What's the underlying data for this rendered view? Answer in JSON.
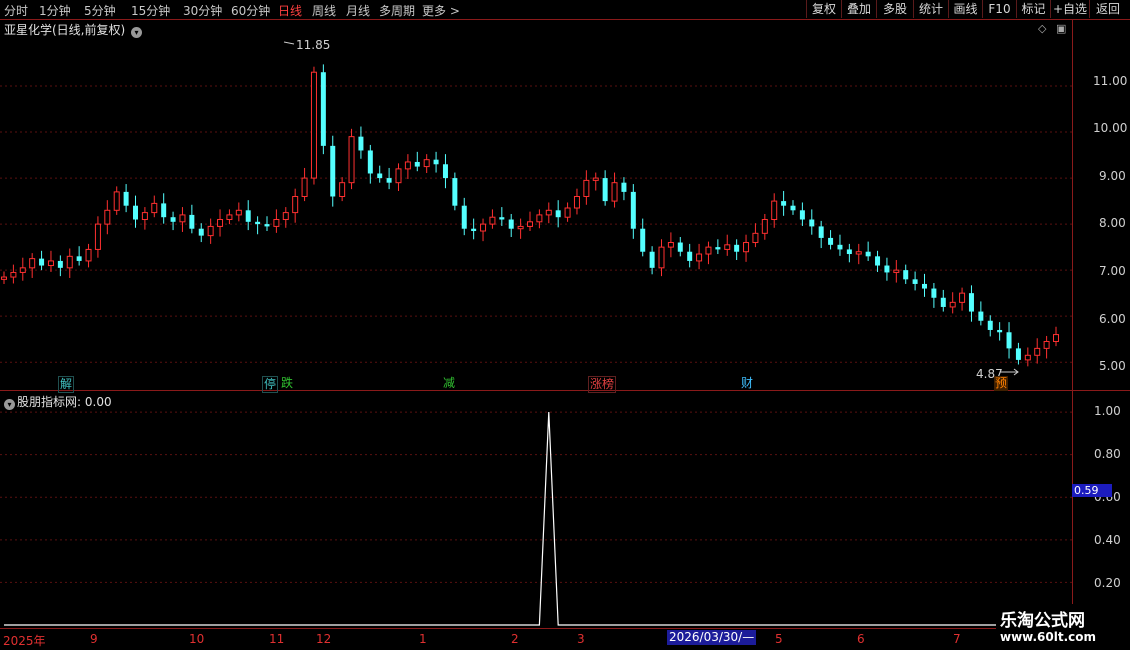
{
  "toolbar": {
    "periods": [
      "分时",
      "1分钟",
      "5分钟",
      "15分钟",
      "30分钟",
      "60分钟",
      "日线",
      "周线",
      "月线",
      "多周期",
      "更多"
    ],
    "active_period": "日线",
    "more_arrow": ">",
    "buttons": [
      "复权",
      "叠加",
      "多股",
      "统计",
      "画线",
      "F10",
      "标记",
      "+自选",
      "返回"
    ]
  },
  "main_panel": {
    "title": "亚星化学(日线,前复权)",
    "price_axis": [
      "11.00",
      "10.00",
      "9.00",
      "8.00",
      "7.00",
      "6.00",
      "5.00"
    ],
    "high_label": "11.85",
    "low_label": "4.87",
    "event_tags": [
      {
        "text": "解",
        "color": "#40c0c0"
      },
      {
        "text": "停",
        "color": "#40c0c0"
      },
      {
        "text": "跌",
        "color": "#30c030"
      },
      {
        "text": "减",
        "color": "#30c030"
      },
      {
        "text": "涨榜",
        "color": "#e04040"
      },
      {
        "text": "财",
        "color": "#40c0ff"
      },
      {
        "text": "预",
        "color": "#ff8000"
      }
    ]
  },
  "indicator_panel": {
    "title": "股朋指标网",
    "value_label": ": 0.00",
    "axis": [
      "1.00",
      "0.80",
      "0.60",
      "0.40",
      "0.20"
    ],
    "current_value": "0.59"
  },
  "date_axis": {
    "labels": [
      "2025年",
      "9",
      "10",
      "11",
      "12",
      "1",
      "2",
      "3",
      "5",
      "6",
      "7"
    ],
    "highlight": "2026/03/30/—"
  },
  "watermark": {
    "line1": "乐淘公式网",
    "line2": "www.60lt.com"
  },
  "colors": {
    "up": "#ff3030",
    "down": "#54ffff",
    "border": "#8a1a1a",
    "grid": "#5a1010",
    "axis_text": "#d0d0d0"
  },
  "chart_data": {
    "type": "candlestick",
    "ylim": [
      4.7,
      12.0
    ],
    "series": [
      {
        "values": [
          6.85,
          6.95,
          7.05,
          7.25,
          7.1,
          7.2,
          7.05,
          7.3,
          7.2,
          7.45,
          8.0,
          8.3,
          8.7,
          8.4,
          8.1,
          8.25,
          8.45,
          8.15,
          8.05,
          8.2,
          7.9,
          7.75,
          7.95,
          8.1,
          8.2,
          8.3,
          8.05,
          8.0,
          7.95,
          8.1,
          8.25,
          8.6,
          9.0,
          11.3,
          9.7,
          8.6,
          8.9,
          9.9,
          9.6,
          9.1,
          9.0,
          8.9,
          9.2,
          9.35,
          9.25,
          9.4,
          9.3,
          9.0,
          8.4,
          7.9,
          7.85,
          8.0,
          8.15,
          8.1,
          7.9,
          7.95,
          8.05,
          8.2,
          8.3,
          8.15,
          8.35,
          8.6,
          8.95,
          9.0,
          8.5,
          8.9,
          8.7,
          7.9,
          7.4,
          7.05,
          7.5,
          7.6,
          7.4,
          7.2,
          7.35,
          7.5,
          7.45,
          7.55,
          7.4,
          7.6,
          7.8,
          8.1,
          8.5,
          8.4,
          8.3,
          8.1,
          7.95,
          7.7,
          7.55,
          7.45,
          7.35,
          7.4,
          7.3,
          7.1,
          6.95,
          7.0,
          6.8,
          6.7,
          6.6,
          6.4,
          6.2,
          6.3,
          6.5,
          6.1,
          5.9,
          5.7,
          5.65,
          5.3,
          5.05,
          5.15,
          5.3,
          5.45,
          5.6
        ]
      }
    ],
    "indicator": {
      "name": "股朋指标网",
      "peak_index": 58,
      "peak_value": 1.0,
      "baseline": 0.0
    }
  }
}
